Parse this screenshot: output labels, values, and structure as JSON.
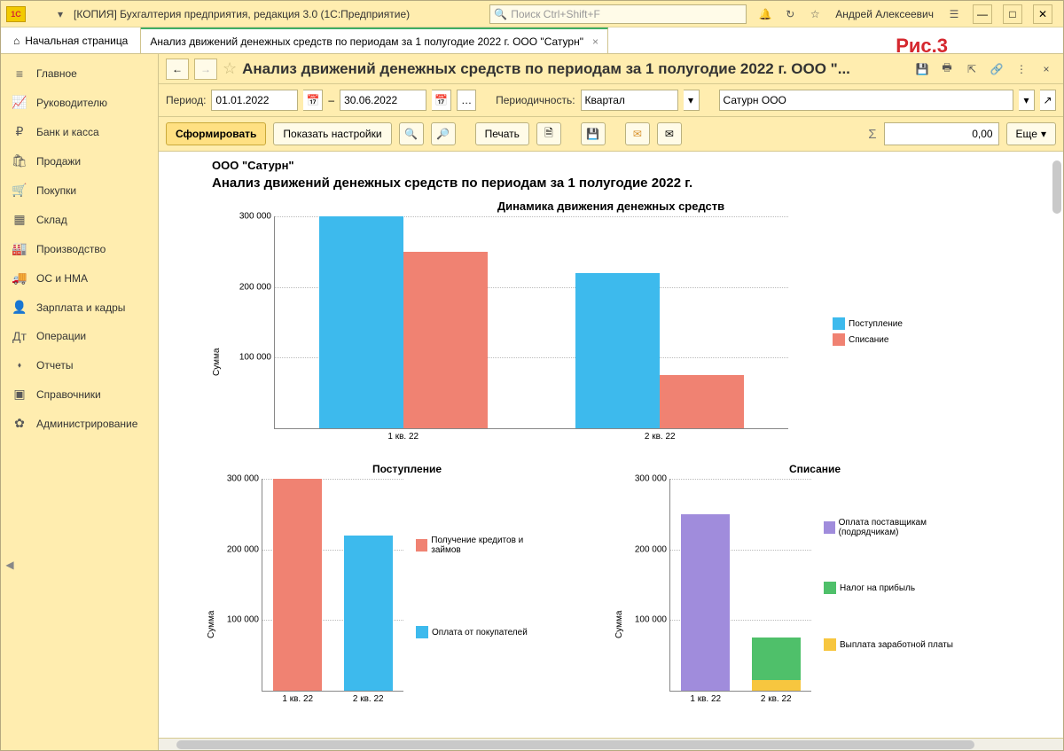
{
  "app": {
    "title": "[КОПИЯ] Бухгалтерия предприятия, редакция 3.0  (1С:Предприятие)",
    "search_placeholder": "Поиск Ctrl+Shift+F",
    "username": "Андрей Алексеевич"
  },
  "tabs": {
    "home": "Начальная страница",
    "doc": "Анализ движений денежных средств по периодам за 1 полугодие 2022 г. ООО \"Сатурн\""
  },
  "fig_label": "Рис.3",
  "sidebar": [
    {
      "icon": "≡",
      "label": "Главное"
    },
    {
      "icon": "📈",
      "label": "Руководителю"
    },
    {
      "icon": "₽",
      "label": "Банк и касса"
    },
    {
      "icon": "🛍",
      "label": "Продажи"
    },
    {
      "icon": "🛒",
      "label": "Покупки"
    },
    {
      "icon": "▦",
      "label": "Склад"
    },
    {
      "icon": "🏭",
      "label": "Производство"
    },
    {
      "icon": "🚚",
      "label": "ОС и НМА"
    },
    {
      "icon": "👤",
      "label": "Зарплата и кадры"
    },
    {
      "icon": "Дт",
      "label": "Операции"
    },
    {
      "icon": "⬪",
      "label": "Отчеты"
    },
    {
      "icon": "▣",
      "label": "Справочники"
    },
    {
      "icon": "✿",
      "label": "Администрирование"
    }
  ],
  "doc": {
    "title": "Анализ движений денежных средств по периодам за 1 полугодие 2022 г. ООО \"...",
    "period_label": "Период:",
    "date_from": "01.01.2022",
    "date_sep": "–",
    "date_to": "30.06.2022",
    "periodicity_label": "Периодичность:",
    "periodicity_value": "Квартал",
    "org": "Сатурн ООО",
    "btn_generate": "Сформировать",
    "btn_settings": "Показать настройки",
    "btn_print": "Печать",
    "sum_value": "0,00",
    "btn_more": "Еще",
    "sigma": "Σ"
  },
  "report": {
    "org_line": "ООО \"Сатурн\"",
    "title": "Анализ движений денежных средств по периодам за 1 полугодие 2022 г."
  },
  "chart_data": [
    {
      "type": "bar",
      "title": "Динамика движения денежных средств",
      "ylabel": "Сумма",
      "categories": [
        "1 кв. 22",
        "2 кв. 22"
      ],
      "series": [
        {
          "name": "Поступление",
          "color": "#3dbaed",
          "values": [
            300000,
            220000
          ]
        },
        {
          "name": "Списание",
          "color": "#f08272",
          "values": [
            250000,
            75000
          ]
        }
      ],
      "ylim": [
        0,
        300000
      ],
      "yticks": [
        100000,
        200000,
        300000
      ],
      "ytick_labels": [
        "100 000",
        "200 000",
        "300 000"
      ]
    },
    {
      "type": "stacked-bar",
      "title": "Поступление",
      "ylabel": "Сумма",
      "categories": [
        "1 кв. 22",
        "2 кв. 22"
      ],
      "series": [
        {
          "name": "Получение кредитов и займов",
          "color": "#f08272",
          "values": [
            300000,
            0
          ]
        },
        {
          "name": "Оплата от покупателей",
          "color": "#3dbaed",
          "values": [
            0,
            220000
          ]
        }
      ],
      "ylim": [
        0,
        300000
      ],
      "yticks": [
        100000,
        200000,
        300000
      ],
      "ytick_labels": [
        "100 000",
        "200 000",
        "300 000"
      ]
    },
    {
      "type": "stacked-bar",
      "title": "Списание",
      "ylabel": "Сумма",
      "categories": [
        "1 кв. 22",
        "2 кв. 22"
      ],
      "series": [
        {
          "name": "Оплата поставщикам (подрядчикам)",
          "color": "#a08cdc",
          "values": [
            250000,
            0
          ]
        },
        {
          "name": "Налог на прибыль",
          "color": "#4fc06a",
          "values": [
            0,
            60000
          ]
        },
        {
          "name": "Выплата заработной платы",
          "color": "#f7c63f",
          "values": [
            0,
            15000
          ]
        }
      ],
      "ylim": [
        0,
        300000
      ],
      "yticks": [
        100000,
        200000,
        300000
      ],
      "ytick_labels": [
        "100 000",
        "200 000",
        "300 000"
      ]
    }
  ]
}
